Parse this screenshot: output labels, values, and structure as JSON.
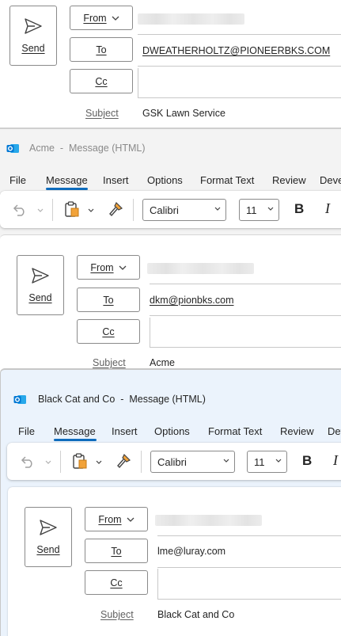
{
  "windows": [
    {
      "title": "",
      "send_label": "Send",
      "from_label": "From",
      "to_label": "To",
      "cc_label": "Cc",
      "to_value": "DWEATHERHOLTZ@PIONEERBKS.COM",
      "subject_label": "Subject",
      "subject_value": "GSK Lawn Service"
    },
    {
      "title": "Acme  -  Message (HTML)",
      "send_label": "Send",
      "from_label": "From",
      "to_label": "To",
      "cc_label": "Cc",
      "to_value": "dkm@pionbks.com",
      "subject_label": "Subject",
      "subject_value": "Acme",
      "menu": [
        "File",
        "Message",
        "Insert",
        "Options",
        "Format Text",
        "Review",
        "Deve"
      ],
      "font_name": "Calibri",
      "font_size": "11",
      "bold_label": "B",
      "italic_label": "I"
    },
    {
      "title": "Black Cat and Co  -  Message (HTML)",
      "send_label": "Send",
      "from_label": "From",
      "to_label": "To",
      "cc_label": "Cc",
      "to_value": "lme@luray.com",
      "subject_label": "Subject",
      "subject_value": "Black Cat and Co",
      "menu": [
        "File",
        "Message",
        "Insert",
        "Options",
        "Format Text",
        "Review",
        "Dev"
      ],
      "font_name": "Calibri",
      "font_size": "11",
      "bold_label": "B",
      "italic_label": "I"
    }
  ],
  "colors": {
    "accent": "#0f6cbd",
    "window_bg_active": "#ebf3fc",
    "window_bg_inactive": "#f3f3f3",
    "outlook_blue": "#0078d4"
  },
  "icons": [
    "send-icon",
    "outlook-icon",
    "undo-icon",
    "clipboard-paste-icon",
    "format-painter-icon",
    "chevron-down-icon"
  ]
}
